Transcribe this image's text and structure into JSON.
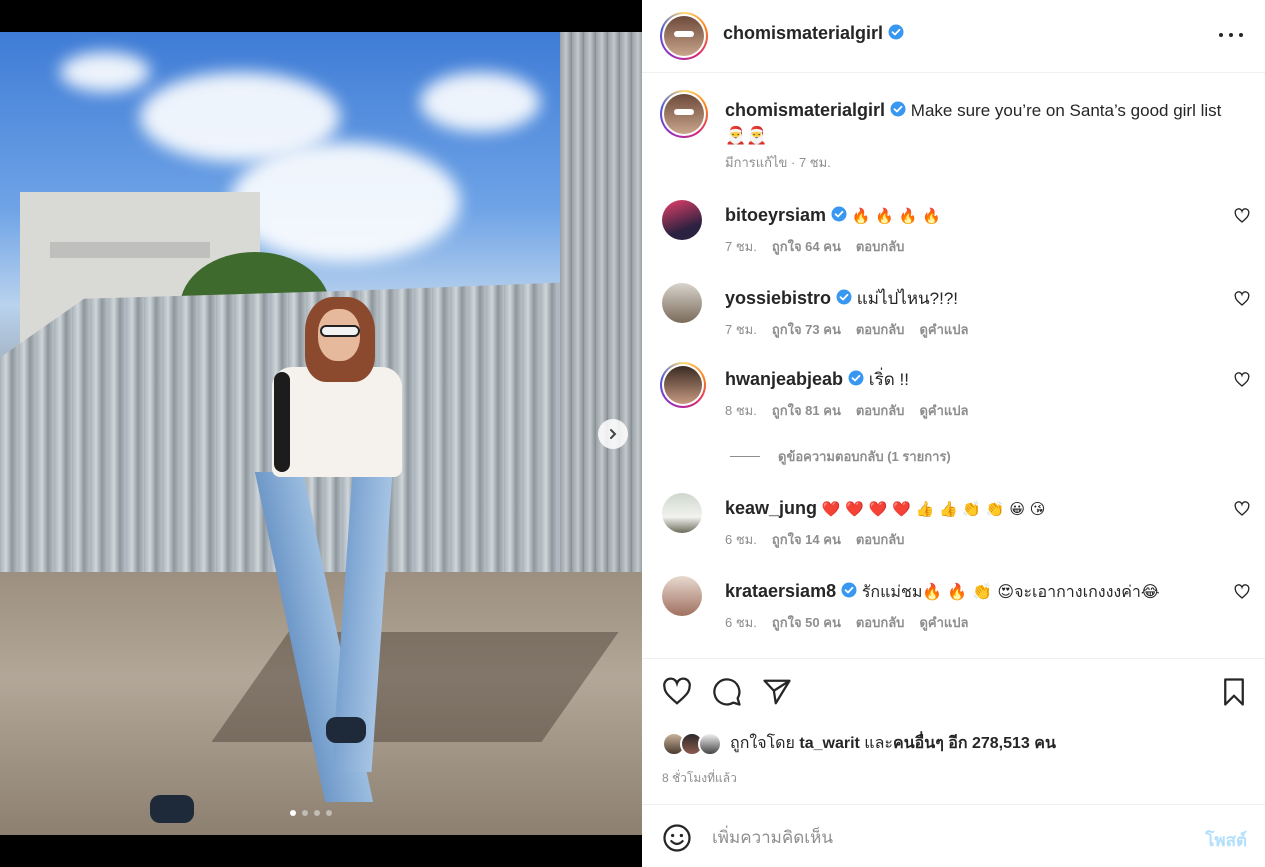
{
  "post": {
    "username": "chomismaterialgirl",
    "verified": true,
    "caption": {
      "text": "Make sure you’re on Santa’s good girl list 🎅🎅",
      "meta": "มีการแก้ไข · 7 ชม."
    },
    "carousel": {
      "dot_count": 4,
      "active_index": 0
    }
  },
  "comments": [
    {
      "username": "bitoeyrsiam",
      "verified": true,
      "text": "🔥 🔥 🔥 🔥",
      "time": "7 ชม.",
      "likes": "ถูกใจ 64 คน",
      "reply": "ตอบกลับ",
      "translate": ""
    },
    {
      "username": "yossiebistro",
      "verified": true,
      "text": "แม่ไปไหน?!?!",
      "time": "7 ชม.",
      "likes": "ถูกใจ 73 คน",
      "reply": "ตอบกลับ",
      "translate": "ดูคำแปล"
    },
    {
      "username": "hwanjeabjeab",
      "verified": true,
      "text": "เริ่ด !!",
      "time": "8 ชม.",
      "likes": "ถูกใจ 81 คน",
      "reply": "ตอบกลับ",
      "translate": "ดูคำแปล"
    },
    {
      "username": "keaw_jung",
      "verified": false,
      "text": "❤️ ❤️ ❤️ ❤️ 👍 👍 👏 👏 😀 😘",
      "time": "6 ชม.",
      "likes": "ถูกใจ 14 คน",
      "reply": "ตอบกลับ",
      "translate": ""
    },
    {
      "username": "krataersiam8",
      "verified": true,
      "text": "รักแม่ชม🔥 🔥 👏 😍จะเอากางเกงงงค่า😂",
      "time": "6 ชม.",
      "likes": "ถูกใจ 50 คน",
      "reply": "ตอบกลับ",
      "translate": "ดูคำแปล"
    }
  ],
  "view_replies": "ดูข้อความตอบกลับ (1 รายการ)",
  "likes_line": {
    "prefix": "ถูกใจโดย ",
    "user": "ta_warit",
    "middle": " และ",
    "others": "คนอื่นๆ อีก 278,513 คน"
  },
  "time_ago": "8 ชั่วโมงที่แล้ว",
  "add_comment": {
    "placeholder": "เพิ่มความคิดเห็น",
    "post_label": "โพสต์"
  },
  "icons": {
    "verified": "verified-badge-icon",
    "like": "heart-icon",
    "comment": "comment-bubble-icon",
    "share": "paper-plane-icon",
    "save": "bookmark-icon",
    "more": "more-options-icon",
    "emoji": "smiley-icon",
    "next": "chevron-right-icon"
  },
  "colors": {
    "verified": "#3897f0",
    "post_button_disabled": "#b2dffc",
    "meta_gray": "#8e8e8e"
  }
}
